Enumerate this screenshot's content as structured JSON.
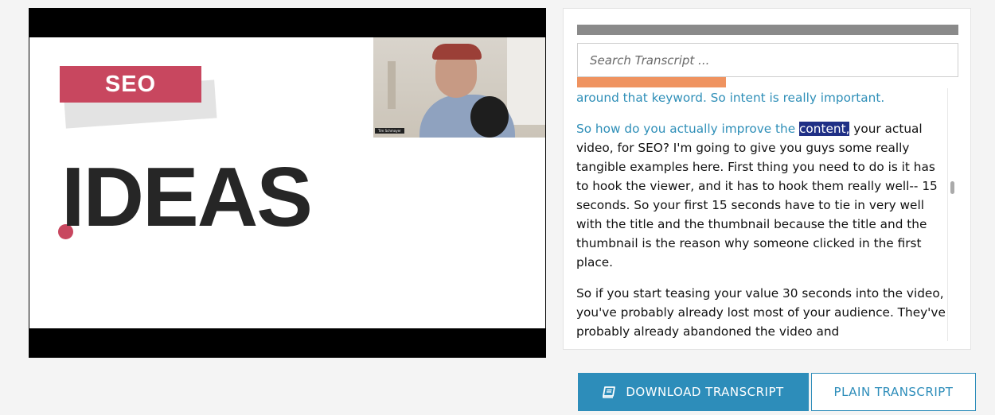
{
  "video": {
    "slide_badge": "SEO",
    "slide_title": "IDEAS",
    "webcam_name": "Tim Schmoyer"
  },
  "transcript_panel": {
    "search_placeholder": "Search Transcript ...",
    "progress_fraction": 0.39,
    "paragraphs": {
      "p1": {
        "played": "around that keyword. So intent is really important."
      },
      "p2": {
        "played": "So how do you actually improve the ",
        "highlight": "content,",
        "rest": " your actual video, for SEO? I'm going to give you guys some really tangible examples here. First thing you need to do is it has to hook the viewer, and it has to hook them really well-- 15 seconds. So your first 15 seconds have to tie in very well with the title and the thumbnail because the title and the thumbnail is the reason why someone clicked in the first place."
      },
      "p3": {
        "text": "So if you start teasing your value 30 seconds into the video, you've probably already lost most of your audience. They've probably already abandoned the video and"
      }
    },
    "colors": {
      "played_text": "#2f8fb8",
      "highlight_bg": "#1f2f85",
      "progress_fill": "#ef9360",
      "progress_track": "#8a8a8a"
    }
  },
  "buttons": {
    "download_label": "DOWNLOAD TRANSCRIPT",
    "download_icon": "book-icon",
    "plain_label": "PLAIN TRANSCRIPT",
    "accent": "#2d8dba"
  }
}
